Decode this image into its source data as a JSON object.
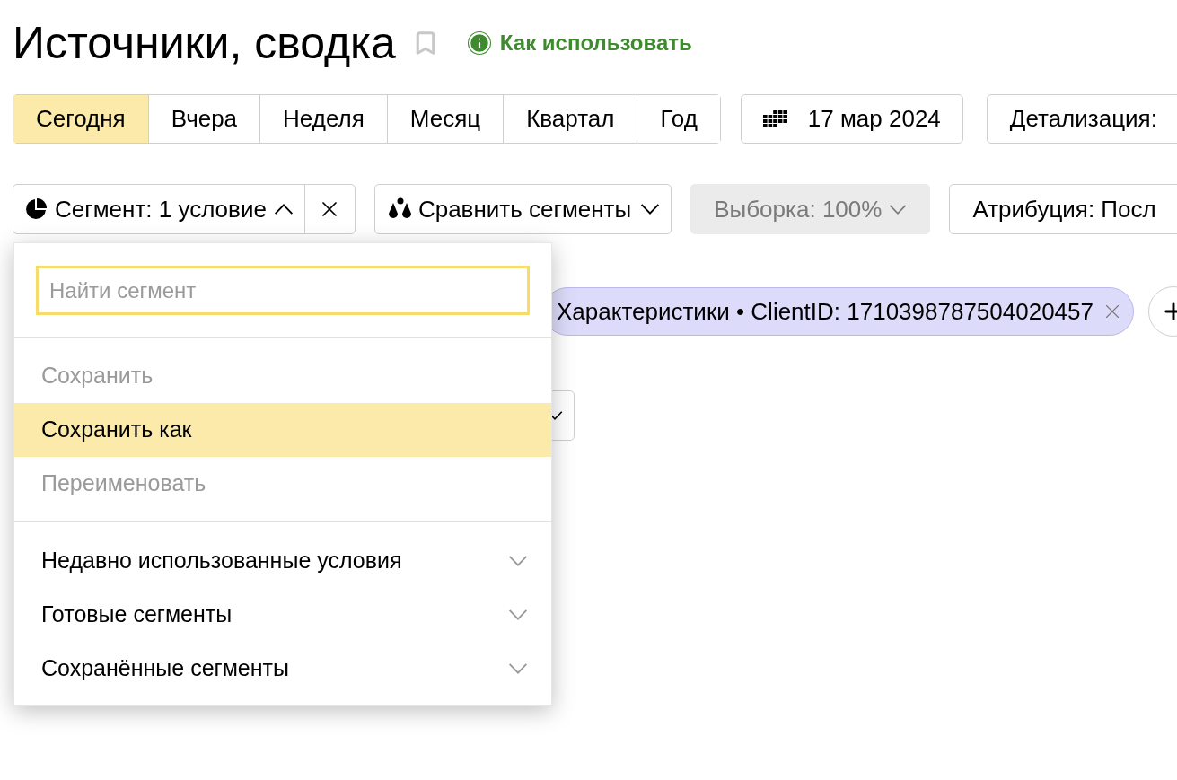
{
  "title": "Источники, сводка",
  "help_link": "Как использовать",
  "periods": [
    {
      "label": "Сегодня",
      "selected": true
    },
    {
      "label": "Вчера",
      "selected": false
    },
    {
      "label": "Неделя",
      "selected": false
    },
    {
      "label": "Месяц",
      "selected": false
    },
    {
      "label": "Квартал",
      "selected": false
    },
    {
      "label": "Год",
      "selected": false
    }
  ],
  "date": "17 мар 2024",
  "detail_button": "Детализация:",
  "segment_button": {
    "label": "Сегмент: 1 условие",
    "expanded": true
  },
  "compare_button": "Сравнить сегменты",
  "sample_button": {
    "label": "Выборка: 100%",
    "disabled": true
  },
  "attribution_button": "Атрибуция: Посл",
  "filter_chip": "Характеристики • ClientID: 1710398787504020457",
  "segment_menu": {
    "search_placeholder": "Найти сегмент",
    "actions": [
      {
        "label": "Сохранить",
        "disabled": true,
        "selected": false
      },
      {
        "label": "Сохранить как",
        "disabled": false,
        "selected": true
      },
      {
        "label": "Переименовать",
        "disabled": true,
        "selected": false
      }
    ],
    "sections": [
      {
        "label": "Недавно использованные условия",
        "expanded": false
      },
      {
        "label": "Готовые сегменты",
        "expanded": false
      },
      {
        "label": "Сохранённые сегменты",
        "expanded": false
      }
    ]
  }
}
